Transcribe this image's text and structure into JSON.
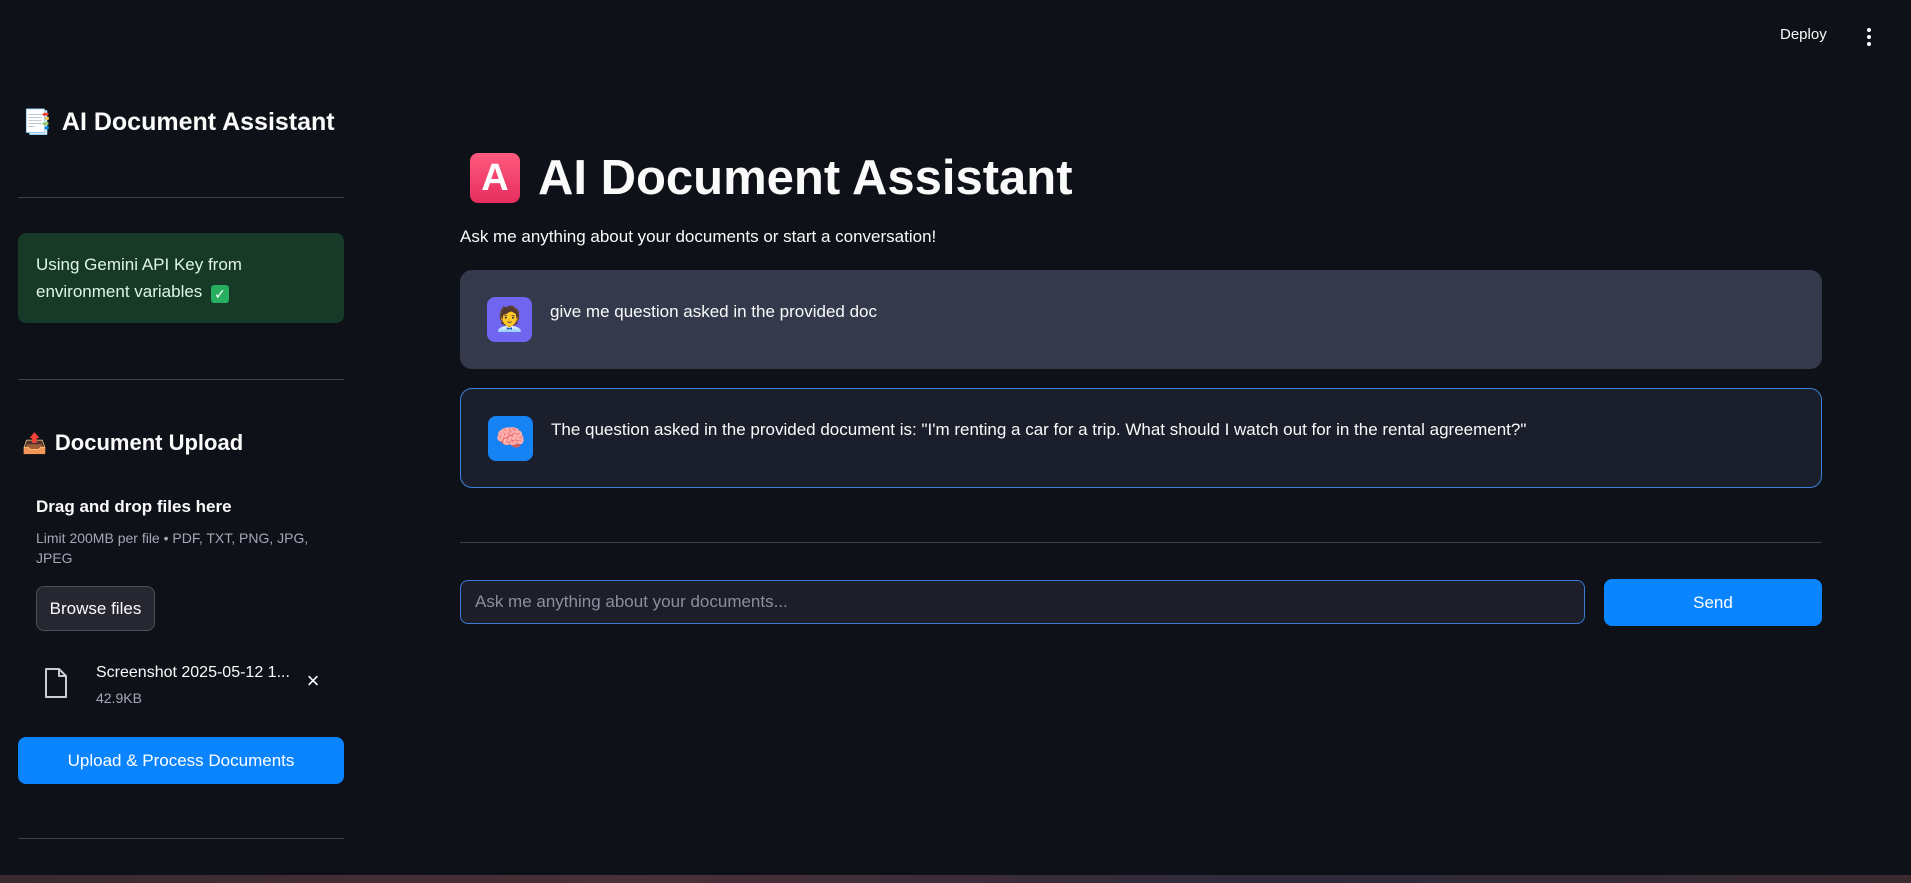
{
  "header": {
    "deploy_label": "Deploy",
    "more_icon": "vertical-ellipsis-icon"
  },
  "sidebar": {
    "title_emoji": "📑",
    "title": "AI Document Assistant",
    "api_status": "Using Gemini API Key from environment variables",
    "api_status_icon": "✓",
    "upload_emoji": "📤",
    "upload_title": "Document Upload",
    "dropzone": {
      "main_text": "Drag and drop files here",
      "limit_text": "Limit 200MB per file • PDF, TXT, PNG, JPG, JPEG",
      "browse_label": "Browse files"
    },
    "file": {
      "name": "Screenshot 2025-05-12 1...",
      "size": "42.9KB",
      "remove_icon": "×"
    },
    "upload_button_label": "Upload & Process Documents"
  },
  "main": {
    "title_badge": "A",
    "title": "AI Document Assistant",
    "subtitle": "Ask me anything about your documents or start a conversation!",
    "messages": [
      {
        "role": "user",
        "avatar": "🧑‍💼",
        "text": "give me question asked in the provided doc"
      },
      {
        "role": "assistant",
        "avatar": "🧠",
        "text": "The question asked in the provided document is: \"I'm renting a car for a trip. What should I watch out for in the rental agreement?\""
      }
    ],
    "input": {
      "value": "",
      "placeholder": "Ask me anything about your documents..."
    },
    "send_label": "Send"
  },
  "colors": {
    "background": "#0e1117",
    "accent": "#0a84ff",
    "success_bg": "#173928",
    "user_msg_bg": "#343a4c",
    "bot_msg_border": "#3b82d6"
  }
}
